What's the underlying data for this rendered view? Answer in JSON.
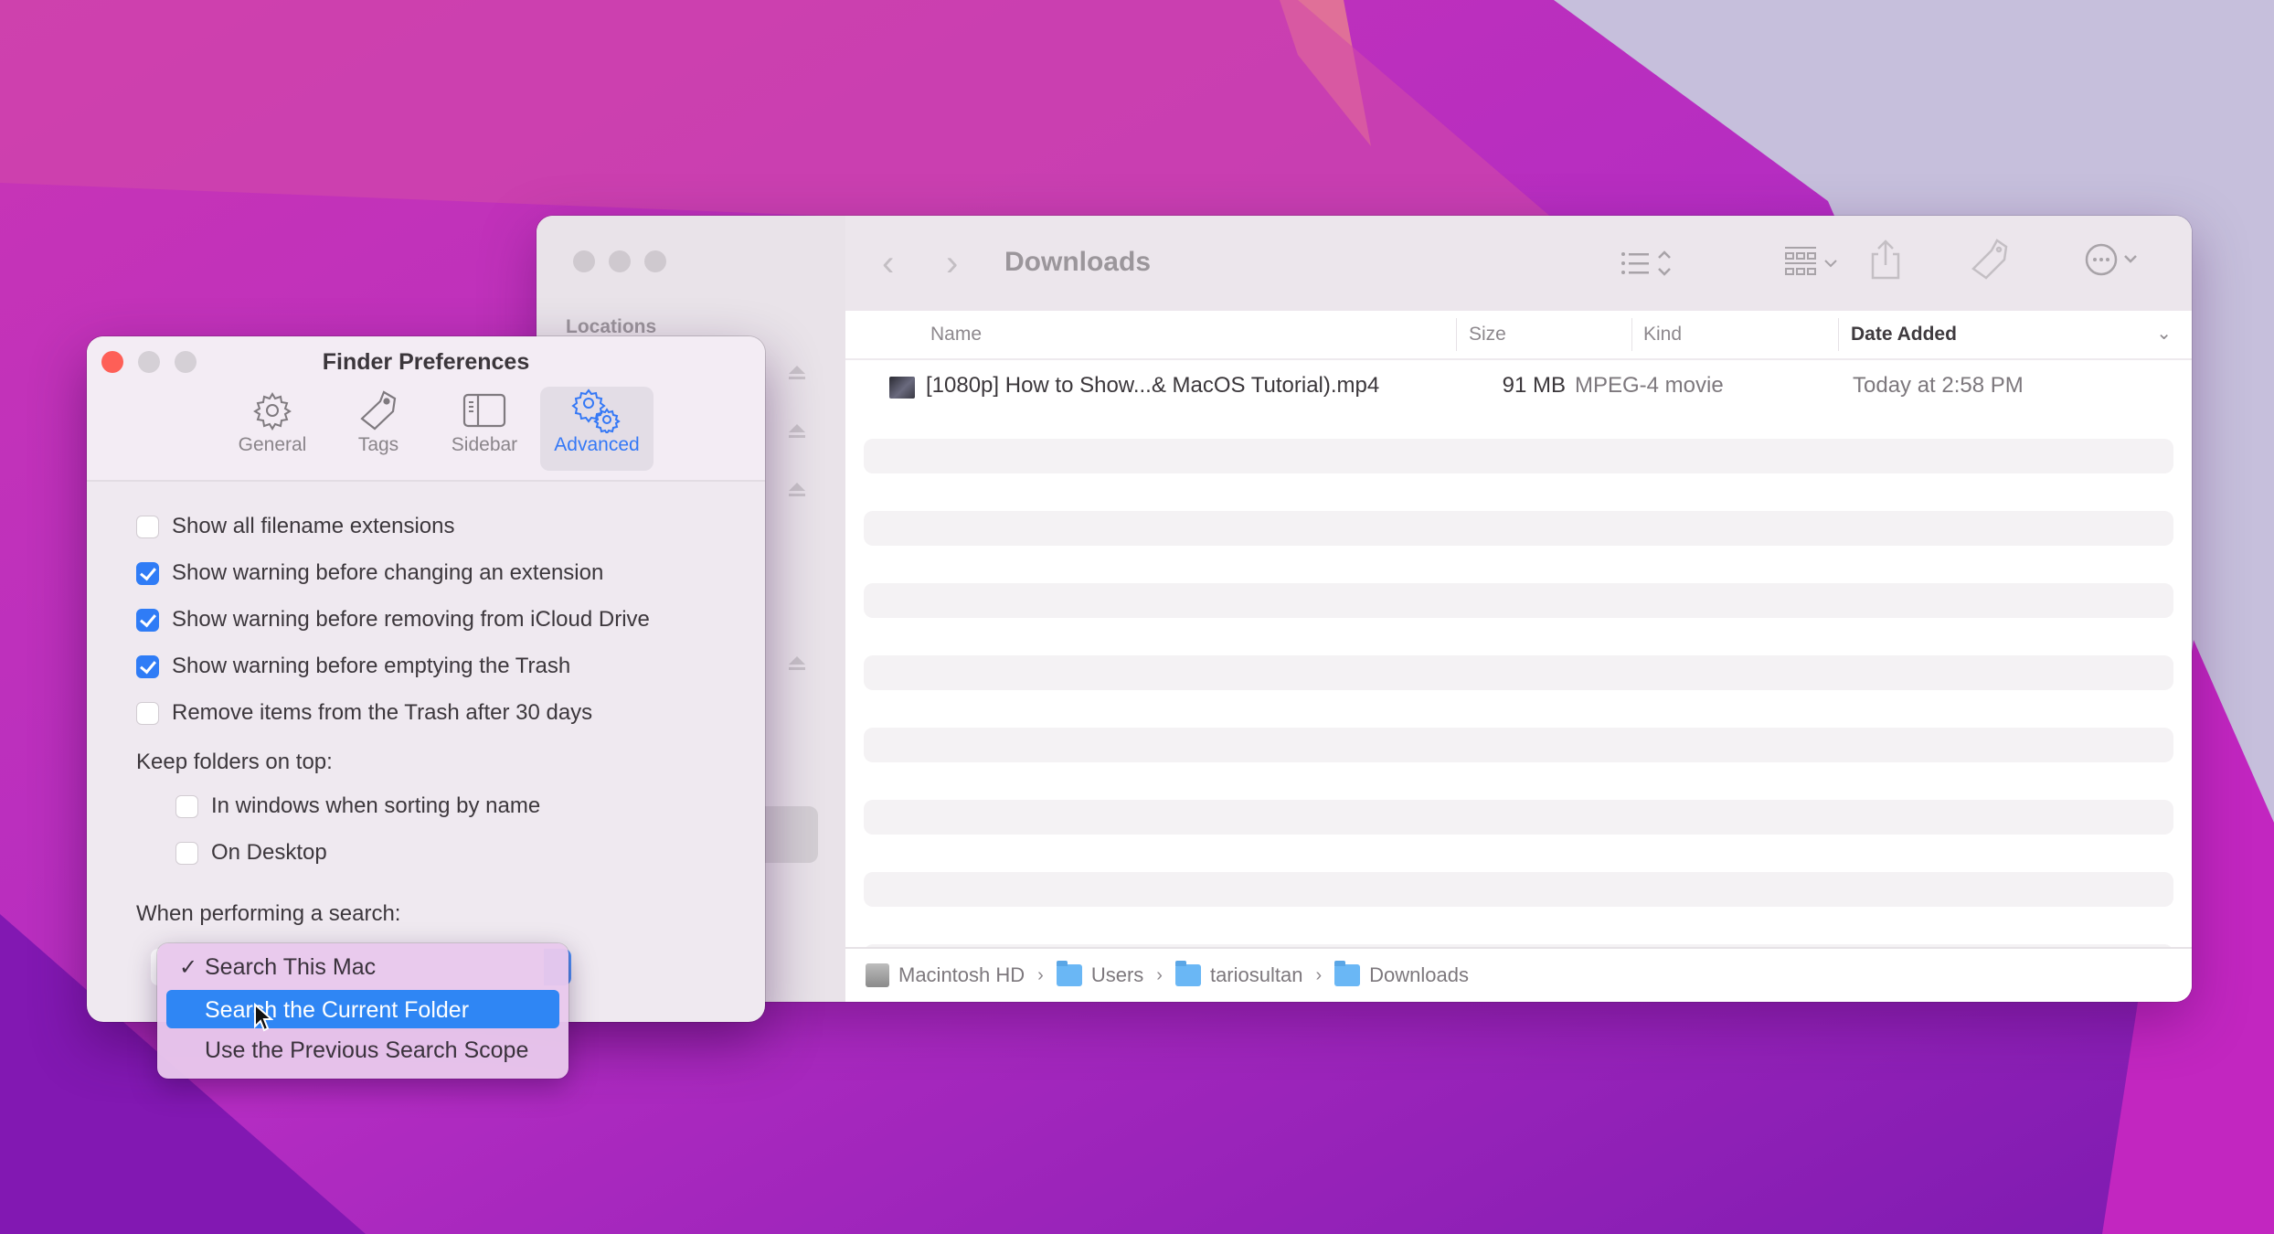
{
  "finder": {
    "title": "Downloads",
    "sidebar": {
      "section_label": "Locations"
    },
    "toolbar": {
      "back_icon": "chevron-left-icon",
      "forward_icon": "chevron-right-icon",
      "view_icon": "list-view-icon",
      "group_icon": "group-icon",
      "share_icon": "share-icon",
      "tag_icon": "tag-icon",
      "action_icon": "more-icon",
      "search_icon": "search-icon"
    },
    "columns": [
      {
        "label": "Name"
      },
      {
        "label": "Size"
      },
      {
        "label": "Kind"
      },
      {
        "label": "Date Added",
        "sorted": true
      }
    ],
    "files": [
      {
        "name": "[1080p] How to Show...& MacOS Tutorial).mp4",
        "size": "91 MB",
        "kind": "MPEG-4 movie",
        "date_added": "Today at 2:58 PM"
      }
    ],
    "path": [
      {
        "label": "Macintosh HD",
        "icon": "hard-drive-icon"
      },
      {
        "label": "Users",
        "icon": "folder-icon"
      },
      {
        "label": "tariosultan",
        "icon": "home-folder-icon"
      },
      {
        "label": "Downloads",
        "icon": "downloads-folder-icon"
      }
    ]
  },
  "prefs": {
    "title": "Finder Preferences",
    "tabs": [
      {
        "label": "General",
        "icon": "gear-icon"
      },
      {
        "label": "Tags",
        "icon": "tag-icon"
      },
      {
        "label": "Sidebar",
        "icon": "sidebar-icon"
      },
      {
        "label": "Advanced",
        "icon": "gears-icon",
        "active": true
      }
    ],
    "options": [
      {
        "label": "Show all filename extensions",
        "checked": false
      },
      {
        "label": "Show warning before changing an extension",
        "checked": true
      },
      {
        "label": "Show warning before removing from iCloud Drive",
        "checked": true
      },
      {
        "label": "Show warning before emptying the Trash",
        "checked": true
      },
      {
        "label": "Remove items from the Trash after 30 days",
        "checked": false
      }
    ],
    "keep_folders_label": "Keep folders on top:",
    "keep_folders": [
      {
        "label": "In windows when sorting by name",
        "checked": false
      },
      {
        "label": "On Desktop",
        "checked": false
      }
    ],
    "search_label": "When performing a search:",
    "search_menu": {
      "selected": "Search This Mac",
      "highlighted": "Search the Current Folder",
      "items": [
        {
          "label": "Search This Mac",
          "checked": true
        },
        {
          "label": "Search the Current Folder",
          "checked": false
        },
        {
          "label": "Use the Previous Search Scope",
          "checked": false
        }
      ],
      "check_glyph": "✓"
    }
  },
  "colors": {
    "accent": "#2f7cf6",
    "menu_highlight": "#2f86f4",
    "close_button": "#fe5f57"
  }
}
